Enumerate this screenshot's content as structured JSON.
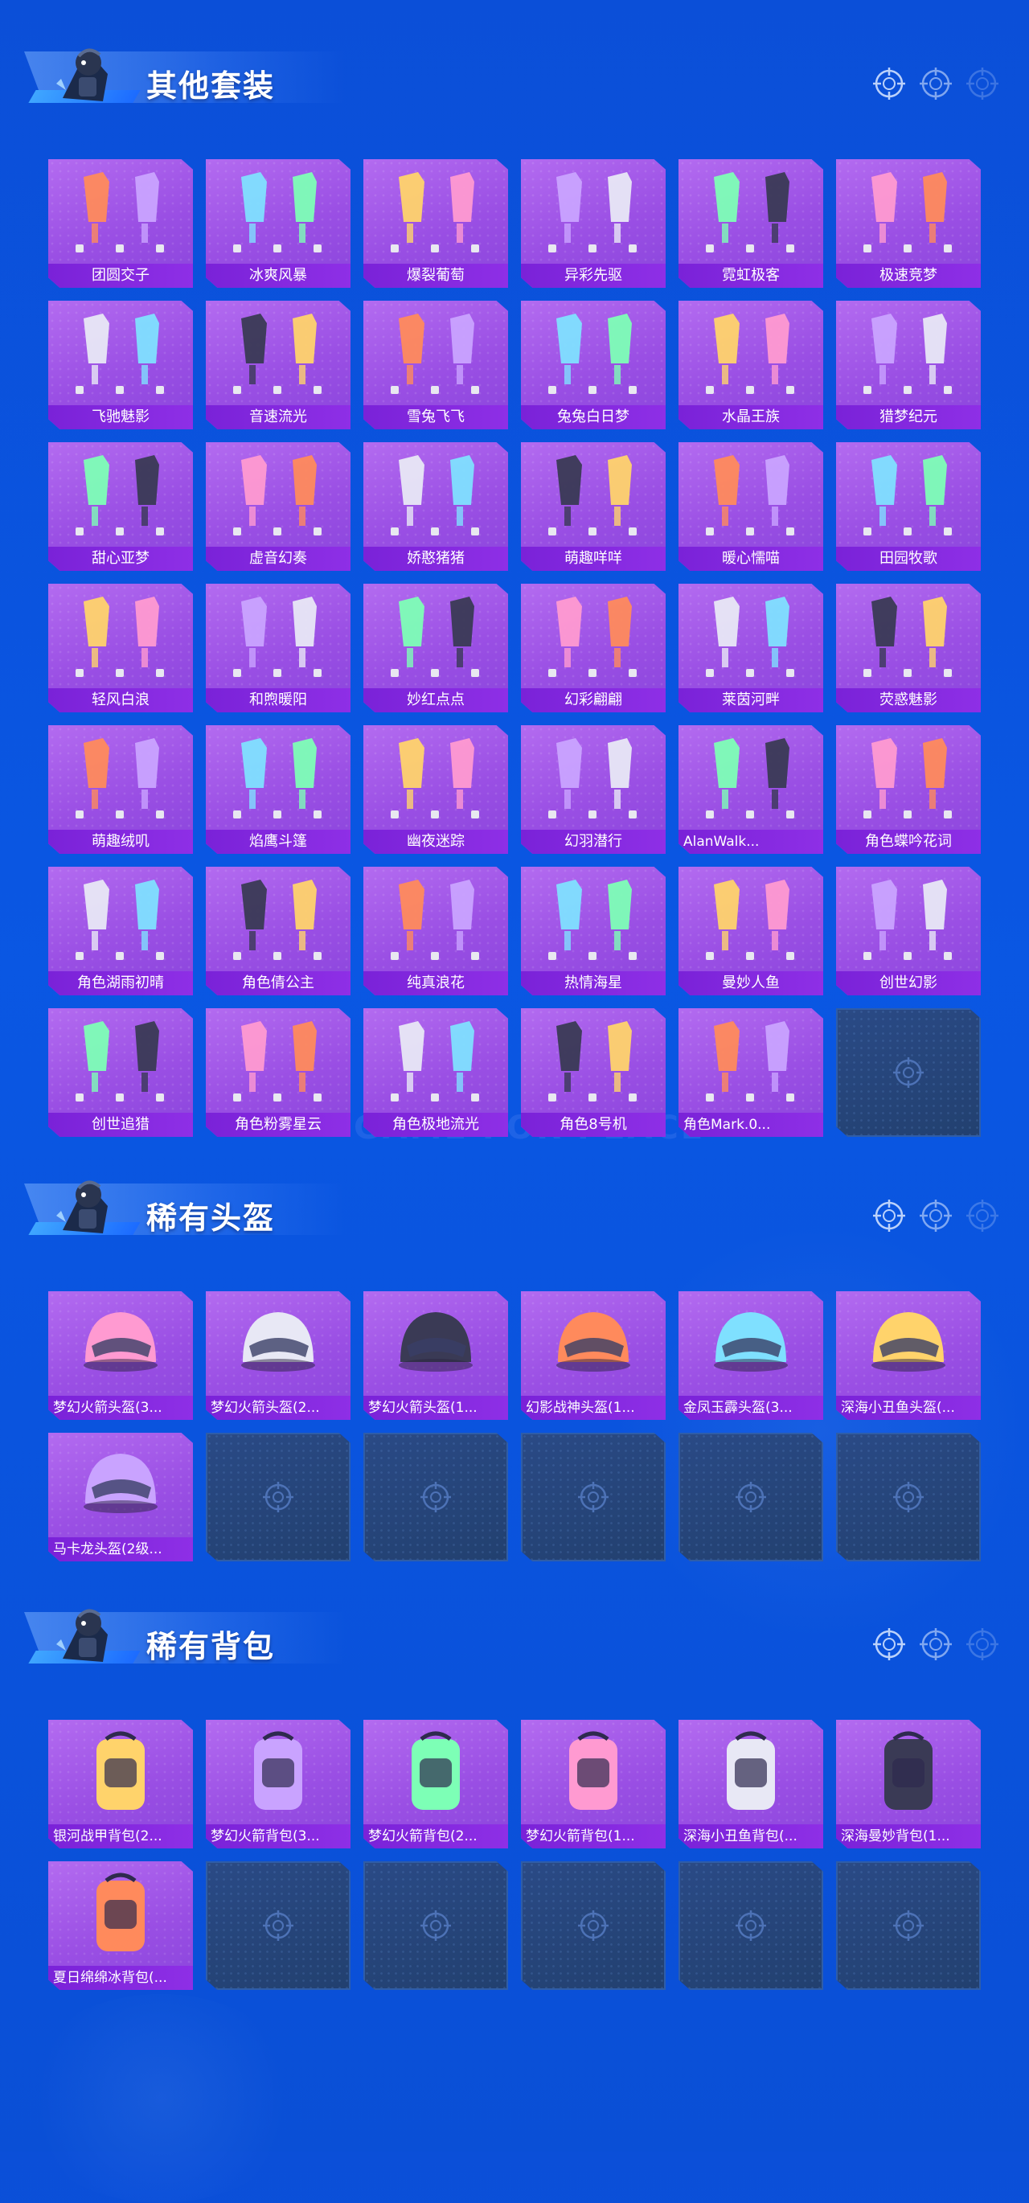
{
  "background_watermark": "GAME FOR PEACE",
  "sections": [
    {
      "title": "其他套装",
      "items": [
        "团圆交子",
        "冰爽风暴",
        "爆裂葡萄",
        "异彩先驱",
        "霓虹极客",
        "极速竞梦",
        "飞驰魅影",
        "音速流光",
        "雪兔飞飞",
        "兔兔白日梦",
        "水晶王族",
        "猎梦纪元",
        "甜心亚梦",
        "虚音幻奏",
        "娇憨猪猪",
        "萌趣咩咩",
        "暖心懦喵",
        "田园牧歌",
        "轻风白浪",
        "和煦暖阳",
        "妙红点点",
        "幻彩翩翩",
        "莱茵河畔",
        "荧惑魅影",
        "萌趣绒叽",
        "焰鹰斗篷",
        "幽夜迷踪",
        "幻羽潜行",
        "AlanWalk...",
        "角色蝶吟花词",
        "角色湖雨初晴",
        "角色倩公主",
        "纯真浪花",
        "热情海星",
        "曼妙人鱼",
        "创世幻影",
        "创世追猎",
        "角色粉雾星云",
        "角色极地流光",
        "角色8号机",
        "角色Mark.0..."
      ],
      "empty_slots": 1
    },
    {
      "title": "稀有头盔",
      "items": [
        "梦幻火箭头盔(3...",
        "梦幻火箭头盔(2...",
        "梦幻火箭头盔(1...",
        "幻影战神头盔(1...",
        "金凤玉霹头盔(3...",
        "深海小丑鱼头盔(...",
        "马卡龙头盔(2级..."
      ],
      "empty_slots": 5
    },
    {
      "title": "稀有背包",
      "items": [
        "银河战甲背包(2...",
        "梦幻火箭背包(3...",
        "梦幻火箭背包(2...",
        "梦幻火箭背包(1...",
        "深海小丑鱼背包(...",
        "深海曼妙背包(1...",
        "夏日绵绵冰背包(..."
      ],
      "empty_slots": 5
    }
  ],
  "icons": {
    "header_mascot": "mascot-icon",
    "header_decor": "crosshair-icon",
    "empty_slot": "target-icon"
  },
  "colors": {
    "page_bg": "#0a55e0",
    "card_purple": "#9a4fe4",
    "label_bar": "#8128df",
    "empty_card": "#22406f"
  }
}
